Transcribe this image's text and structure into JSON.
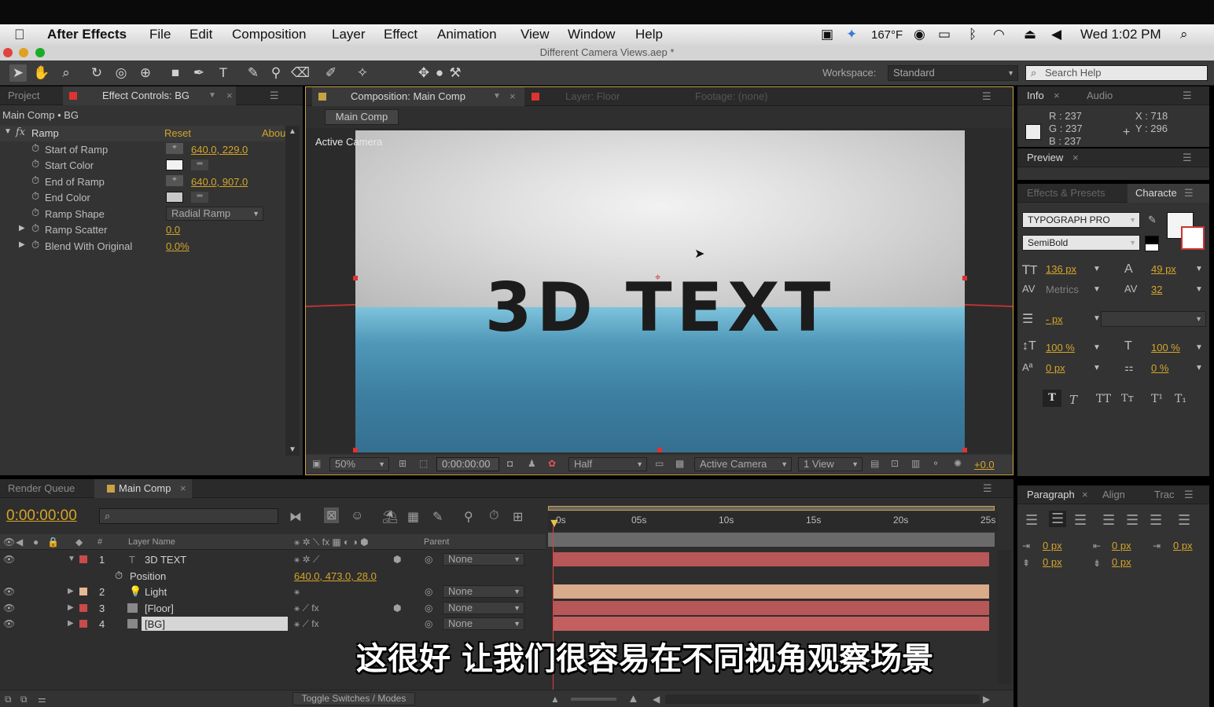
{
  "menubar": {
    "app": "After Effects",
    "items": [
      "File",
      "Edit",
      "Composition",
      "Layer",
      "Effect",
      "Animation",
      "View",
      "Window",
      "Help"
    ],
    "temp": "167°F",
    "clock": "Wed 1:02 PM"
  },
  "window": {
    "title": "Different Camera Views.aep *"
  },
  "toolbar": {
    "workspace_label": "Workspace:",
    "workspace_value": "Standard",
    "search_placeholder": "Search Help"
  },
  "effect_panel": {
    "tab_project": "Project",
    "tab_effect_controls": "Effect Controls: BG",
    "subtitle": "Main Comp • BG",
    "fx_name": "Ramp",
    "reset": "Reset",
    "about": "Abou",
    "params": [
      {
        "label": "Start of Ramp",
        "value": "640.0, 229.0"
      },
      {
        "label": "Start Color",
        "value": ""
      },
      {
        "label": "End of Ramp",
        "value": "640.0, 907.0"
      },
      {
        "label": "End Color",
        "value": ""
      },
      {
        "label": "Ramp Shape",
        "value": "Radial Ramp"
      },
      {
        "label": "Ramp Scatter",
        "value": "0.0"
      },
      {
        "label": "Blend With Original",
        "value": "0.0%"
      }
    ]
  },
  "comp_panel": {
    "tab_comp": "Composition: Main Comp",
    "tab_layer": "Layer: Floor",
    "tab_footage": "Footage: (none)",
    "comp_button": "Main Comp",
    "camera_label": "Active Camera",
    "text": "3D TEXT",
    "bottom": {
      "zoom": "50%",
      "timecode": "0:00:00:00",
      "resolution": "Half",
      "view": "Active Camera",
      "views": "1 View",
      "exposure": "+0.0"
    }
  },
  "info_panel": {
    "tab_info": "Info",
    "tab_audio": "Audio",
    "r": "R : 237",
    "g": "G : 237",
    "b": "B : 237",
    "x": "X : 718",
    "y": "Y : 296"
  },
  "preview_panel": {
    "tab": "Preview"
  },
  "char_panel": {
    "tab_effects": "Effects & Presets",
    "tab_char": "Characte",
    "font": "TYPOGRAPH PRO",
    "style": "SemiBold",
    "size": "136 px",
    "leading": "49 px",
    "kerning": "Metrics",
    "tracking": "32",
    "stroke": "- px",
    "vscale": "100 %",
    "hscale": "100 %",
    "baseline": "0 px",
    "tsume": "0 %"
  },
  "para_panel": {
    "tab_para": "Paragraph",
    "tab_align": "Align",
    "tab_track": "Trac",
    "indent1": "0 px",
    "indent2": "0 px",
    "indent3": "0 px",
    "space1": "0 px",
    "space2": "0 px"
  },
  "timeline": {
    "tab_render": "Render Queue",
    "tab_main": "Main Comp",
    "timecode": "0:00:00:00",
    "col_layer": "Layer Name",
    "col_parent": "Parent",
    "col_num": "#",
    "ruler": [
      "0s",
      "05s",
      "10s",
      "15s",
      "20s",
      "25s"
    ],
    "layers": [
      {
        "num": "1",
        "name": "3D TEXT",
        "parent": "None",
        "color": "#c94b4b"
      },
      {
        "num": "",
        "name": "Position",
        "parent": "",
        "value": "640.0, 473.0, 28.0"
      },
      {
        "num": "2",
        "name": "Light",
        "parent": "None",
        "color": "#e6b896"
      },
      {
        "num": "3",
        "name": "[Floor]",
        "parent": "None",
        "color": "#c94b4b"
      },
      {
        "num": "4",
        "name": "[BG]",
        "parent": "None",
        "color": "#c94b4b"
      }
    ],
    "toggle": "Toggle Switches / Modes"
  },
  "subtitle": "这很好 让我们很容易在不同视角观察场景"
}
